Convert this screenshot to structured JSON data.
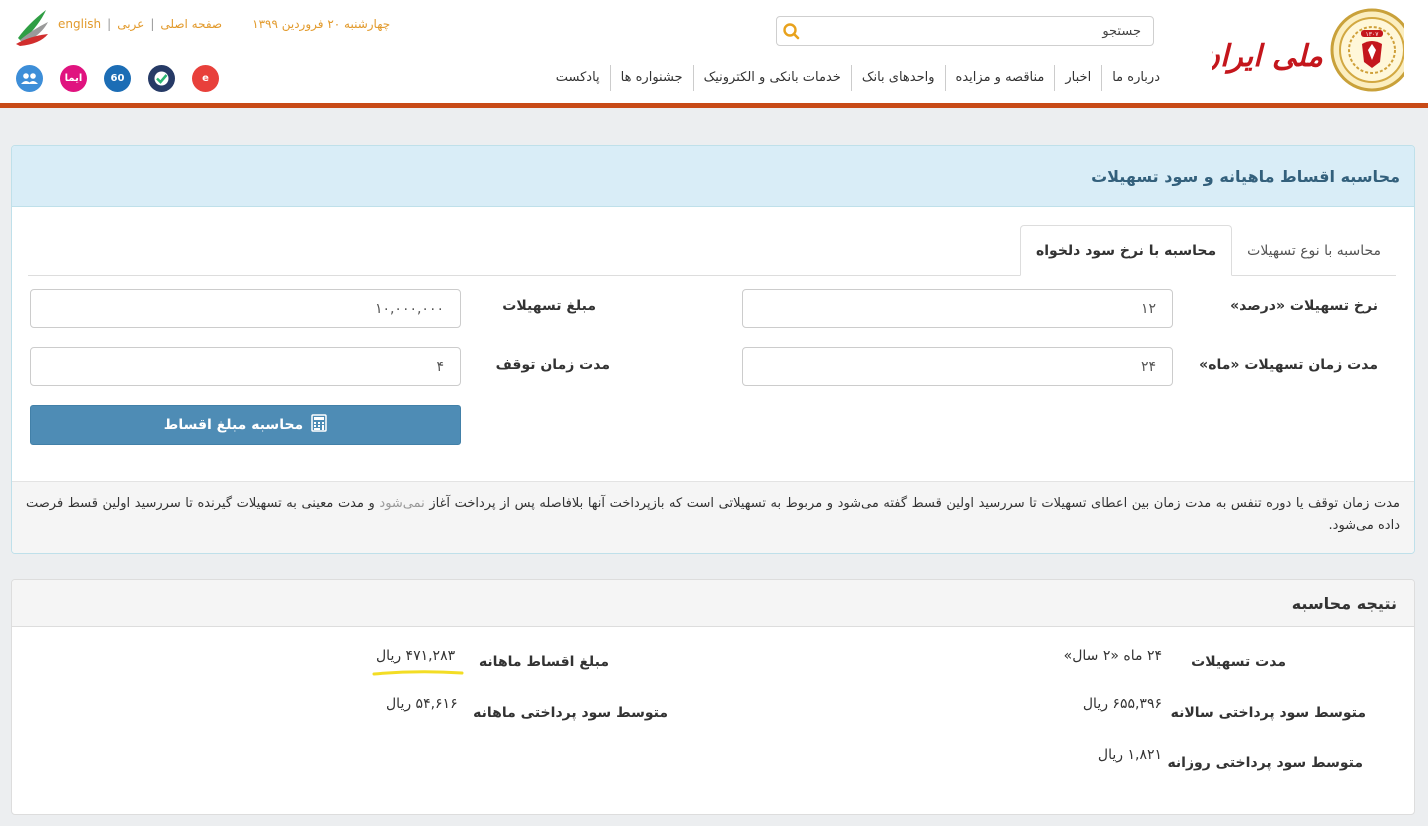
{
  "header": {
    "search_placeholder": "جستجو",
    "nav": [
      "درباره ما",
      "اخبار",
      "مناقصه و مزایده",
      "واحدهای بانک",
      "خدمات بانکی و الکترونیک",
      "جشنواره ها",
      "پادکست"
    ],
    "date": "چهارشنبه ۲۰ فروردین ۱۳۹۹",
    "links": [
      "صفحه اصلی",
      "عربی",
      "english"
    ],
    "logo_text": "بانک ملی ایران",
    "logo_year": "۱۳۰۷",
    "social": [
      {
        "name": "ebank-icon",
        "color": "#e8403b",
        "label": "e"
      },
      {
        "name": "check-shield-icon",
        "color": "#263a66",
        "label": ""
      },
      {
        "name": "bank60-icon",
        "color": "#1c6db5",
        "label": "60"
      },
      {
        "name": "bale-icon",
        "color": "#e0137f",
        "label": "ایما"
      },
      {
        "name": "users-icon",
        "color": "#3d8ed8",
        "label": ""
      }
    ],
    "colors": {
      "bar": "#c84a17",
      "links": "#e29a2c",
      "logo": "#c4161c"
    }
  },
  "calculator": {
    "title": "محاسبه اقساط ماهیانه و سود تسهیلات",
    "tabs": [
      "محاسبه با نوع تسهیلات",
      "محاسبه با نرخ سود دلخواه"
    ],
    "active_tab": 1,
    "rate_label": "نرخ تسهیلات «درصد»",
    "rate_value": "۱۲",
    "amount_label": "مبلغ تسهیلات",
    "amount_value": "۱۰,۰۰۰,۰۰۰",
    "duration_label": "مدت زمان تسهیلات «ماه»",
    "duration_value": "۲۴",
    "grace_label": "مدت زمان توقف",
    "grace_value": "۴",
    "button_label": "محاسبه مبلغ اقساط",
    "note_part1": "مدت زمان توقف یا دوره تنفس به مدت زمان بین اعطای تسهیلات تا سررسید اولین قسط گفته می‌شود و مربوط به تسهیلاتی است که بازپرداخت آنها بلافاصله پس از پرداخت آغاز ",
    "note_muted": "نمی‌شود",
    "note_part2": " و مدت معینی به تسهیلات گیرنده تا سررسید اولین قسط فرصت داده می‌شود."
  },
  "result": {
    "title": "نتیجه محاسبه",
    "duration_label": "مدت تسهیلات",
    "duration_value": "۲۴ ماه «۲ سال»",
    "monthly_label": "مبلغ اقساط ماهانه",
    "monthly_value": "۴۷۱,۲۸۳ ریال",
    "yearly_profit_label": "متوسط سود پرداختی سالانه",
    "yearly_profit_value": "۶۵۵,۳۹۶ ریال",
    "monthly_profit_label": "متوسط سود پرداختی ماهانه",
    "monthly_profit_value": "۵۴,۶۱۶ ریال",
    "daily_profit_label": "متوسط سود پرداختی روزانه",
    "daily_profit_value": "۱,۸۲۱ ریال",
    "highlight_color": "#f3dd24"
  }
}
